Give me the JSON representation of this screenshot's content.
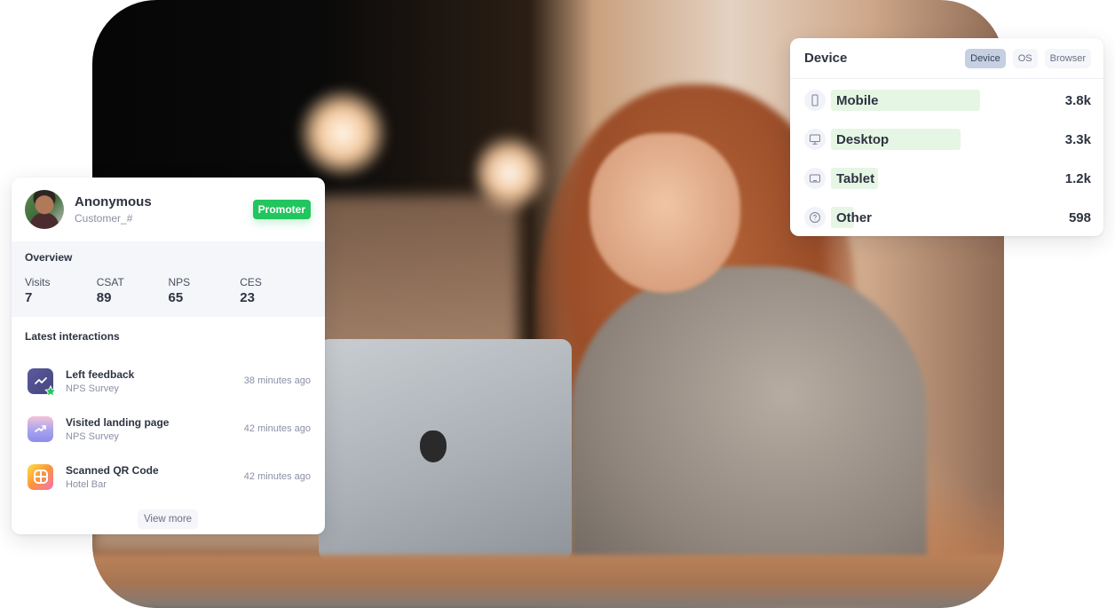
{
  "device_panel": {
    "title": "Device",
    "tabs": [
      {
        "label": "Device",
        "active": true
      },
      {
        "label": "OS",
        "active": false
      },
      {
        "label": "Browser",
        "active": false
      }
    ],
    "rows": [
      {
        "icon": "mobile-phone-icon",
        "label": "Mobile",
        "value": "3.8k",
        "share": 3800
      },
      {
        "icon": "desktop-monitor-icon",
        "label": "Desktop",
        "value": "3.3k",
        "share": 3300
      },
      {
        "icon": "tablet-icon",
        "label": "Tablet",
        "value": "1.2k",
        "share": 1200
      },
      {
        "icon": "question-circle-icon",
        "label": "Other",
        "value": "598",
        "share": 598
      }
    ],
    "bar_color": "#e6f6e4"
  },
  "profile": {
    "name": "Anonymous",
    "customer_id": "Customer_#",
    "badge": "Promoter",
    "badge_color": "#22c55e",
    "overview": {
      "title": "Overview",
      "stats": [
        {
          "label": "Visits",
          "value": "7"
        },
        {
          "label": "CSAT",
          "value": "89"
        },
        {
          "label": "NPS",
          "value": "65"
        },
        {
          "label": "CES",
          "value": "23"
        }
      ]
    },
    "latest": {
      "title": "Latest interactions",
      "items": [
        {
          "icon": "chart-line-star-icon",
          "title": "Left feedback",
          "subtitle": "NPS Survey",
          "time": "38 minutes ago"
        },
        {
          "icon": "trend-up-icon",
          "title": "Visited landing page",
          "subtitle": "NPS Survey",
          "time": "42 minutes ago"
        },
        {
          "icon": "qr-grid-icon",
          "title": "Scanned QR Code",
          "subtitle": "Hotel Bar",
          "time": "42 minutes ago"
        }
      ],
      "view_more": "View more"
    }
  }
}
